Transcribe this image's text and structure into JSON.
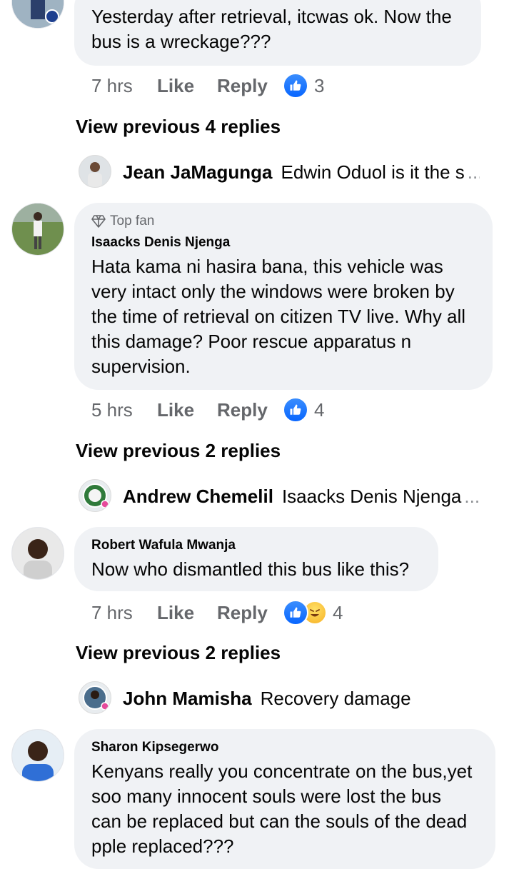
{
  "comments": [
    {
      "author": "",
      "text_lines": [
        "Yesterday after retrieval, itcwas ok. Now the",
        "bus is a wreckage???"
      ],
      "time": "7 hrs",
      "like_label": "Like",
      "reply_label": "Reply",
      "reaction_count": "3",
      "view_previous": "View previous 4 replies",
      "reply_preview": {
        "name": "Jean JaMagunga",
        "text": "Edwin Oduol is it the s",
        "ellipsis": "..."
      }
    },
    {
      "badge": "Top fan",
      "author": "Isaacks Denis Njenga",
      "text_lines": [
        "Hata kama ni hasira bana, this vehicle was",
        "very intact only the windows were broken by",
        "the time of retrieval on citizen TV live. Why all",
        "this damage? Poor rescue apparatus n",
        "supervision."
      ],
      "time": "5 hrs",
      "like_label": "Like",
      "reply_label": "Reply",
      "reaction_count": "4",
      "view_previous": "View previous 2 replies",
      "reply_preview": {
        "name": "Andrew Chemelil",
        "text": "Isaacks Denis Njenga",
        "ellipsis": "..."
      }
    },
    {
      "author": "Robert Wafula Mwanja",
      "text_lines": [
        "Now who dismantled this bus like this?"
      ],
      "time": "7 hrs",
      "like_label": "Like",
      "reply_label": "Reply",
      "reaction_count": "4",
      "view_previous": "View previous 2 replies",
      "reply_preview": {
        "name": "John Mamisha",
        "text": "Recovery damage"
      }
    },
    {
      "author": "Sharon Kipsegerwo",
      "text_lines": [
        "Kenyans really you concentrate on the bus,yet",
        "soo many innocent souls were lost the bus",
        "can be replaced but can the souls of the dead",
        "pple replaced???"
      ]
    }
  ],
  "colors": {
    "like_blue": "#0866ff",
    "bubble_bg": "#f0f2f5",
    "meta_gray": "#65676b"
  }
}
